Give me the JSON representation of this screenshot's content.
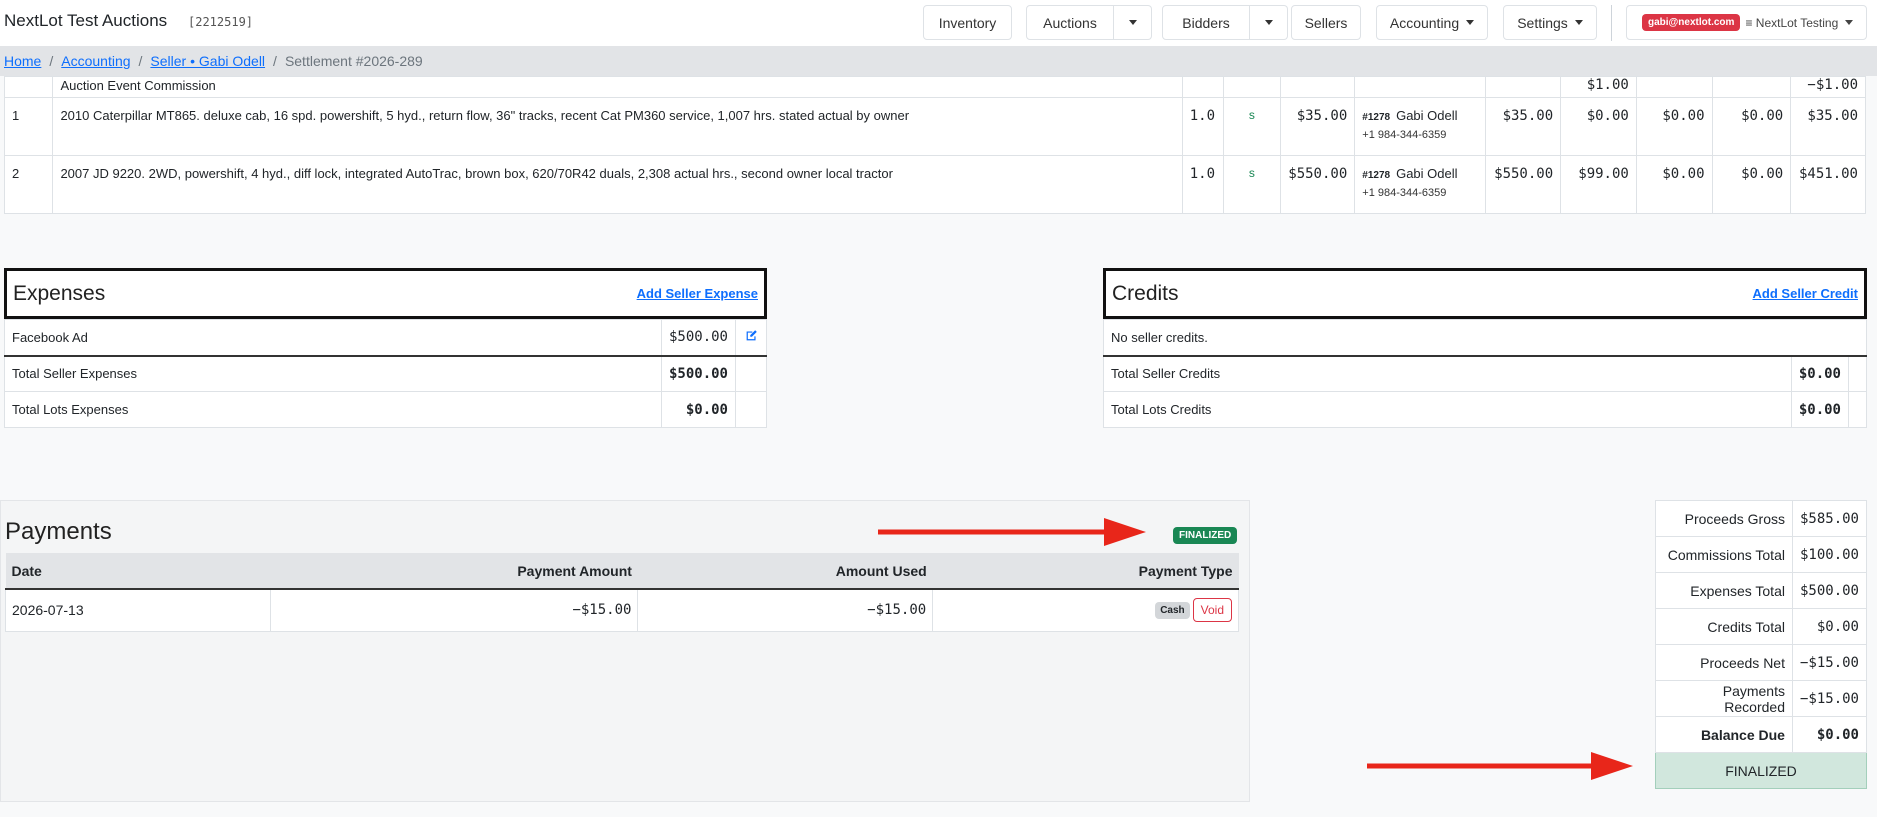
{
  "header": {
    "app_title": "NextLot Test Auctions",
    "app_id": "[2212519]",
    "nav": {
      "inventory": "Inventory",
      "auctions": "Auctions",
      "bidders": "Bidders",
      "sellers": "Sellers",
      "accounting": "Accounting",
      "settings": "Settings"
    },
    "user_email": "gabi@nextlot.com",
    "tenant": "≡ NextLot Testing"
  },
  "breadcrumb": {
    "home": "Home",
    "accounting": "Accounting",
    "seller": "Seller • Gabi Odell",
    "current": "Settlement #2026-289"
  },
  "lots": {
    "partial_row": {
      "description": "Auction Event Commission",
      "col_a": "$1.00",
      "col_b": "−$1.00"
    },
    "rows": [
      {
        "lot": "1",
        "description": "2010 Caterpillar MT865. deluxe cab, 16 spd. powershift, 5 hyd., return flow, 36\" tracks, recent Cat PM360 service, 1,007 hrs. stated actual by owner",
        "qty": "1.0",
        "status": "s",
        "price": "$35.00",
        "bidder_no": "#1278",
        "bidder_name": "Gabi Odell",
        "phone": "+1 984-344-6359",
        "gross": "$35.00",
        "commission": "$0.00",
        "expenses": "$0.00",
        "credits": "$0.00",
        "net": "$35.00"
      },
      {
        "lot": "2",
        "description": "2007 JD 9220. 2WD, powershift, 4 hyd., diff lock, integrated AutoTrac, brown box, 620/70R42 duals, 2,308 actual hrs., second owner local tractor",
        "qty": "1.0",
        "status": "s",
        "price": "$550.00",
        "bidder_no": "#1278",
        "bidder_name": "Gabi Odell",
        "phone": "+1 984-344-6359",
        "gross": "$550.00",
        "commission": "$99.00",
        "expenses": "$0.00",
        "credits": "$0.00",
        "net": "$451.00"
      }
    ]
  },
  "expenses": {
    "title": "Expenses",
    "add_link": "Add Seller Expense",
    "items": [
      {
        "label": "Facebook Ad",
        "amount": "$500.00"
      }
    ],
    "total_seller_label": "Total Seller Expenses",
    "total_seller_amount": "$500.00",
    "total_lots_label": "Total Lots Expenses",
    "total_lots_amount": "$0.00"
  },
  "credits": {
    "title": "Credits",
    "add_link": "Add Seller Credit",
    "empty_text": "No seller credits.",
    "total_seller_label": "Total Seller Credits",
    "total_seller_amount": "$0.00",
    "total_lots_label": "Total Lots Credits",
    "total_lots_amount": "$0.00"
  },
  "payments": {
    "title": "Payments",
    "status_badge": "FINALIZED",
    "columns": {
      "date": "Date",
      "payment_amount": "Payment Amount",
      "amount_used": "Amount Used",
      "payment_type": "Payment Type"
    },
    "rows": [
      {
        "date": "2026-07-13",
        "payment_amount": "−$15.00",
        "amount_used": "−$15.00",
        "type": "Cash",
        "void_label": "Void"
      }
    ]
  },
  "summary": {
    "proceeds_gross_label": "Proceeds Gross",
    "proceeds_gross": "$585.00",
    "commissions_total_label": "Commissions Total",
    "commissions_total": "$100.00",
    "expenses_total_label": "Expenses Total",
    "expenses_total": "$500.00",
    "credits_total_label": "Credits Total",
    "credits_total": "$0.00",
    "proceeds_net_label": "Proceeds Net",
    "proceeds_net": "−$15.00",
    "payments_recorded_label": "Payments Recorded",
    "payments_recorded": "−$15.00",
    "balance_due_label": "Balance Due",
    "balance_due": "$0.00",
    "status": "FINALIZED"
  },
  "colors": {
    "accent": "#0d6efd",
    "finalized": "#198754",
    "danger": "#dc3545",
    "annotation_arrow": "#e8261a"
  },
  "icons": [
    "caret-down-icon",
    "edit-icon",
    "arrow-right-icon"
  ]
}
